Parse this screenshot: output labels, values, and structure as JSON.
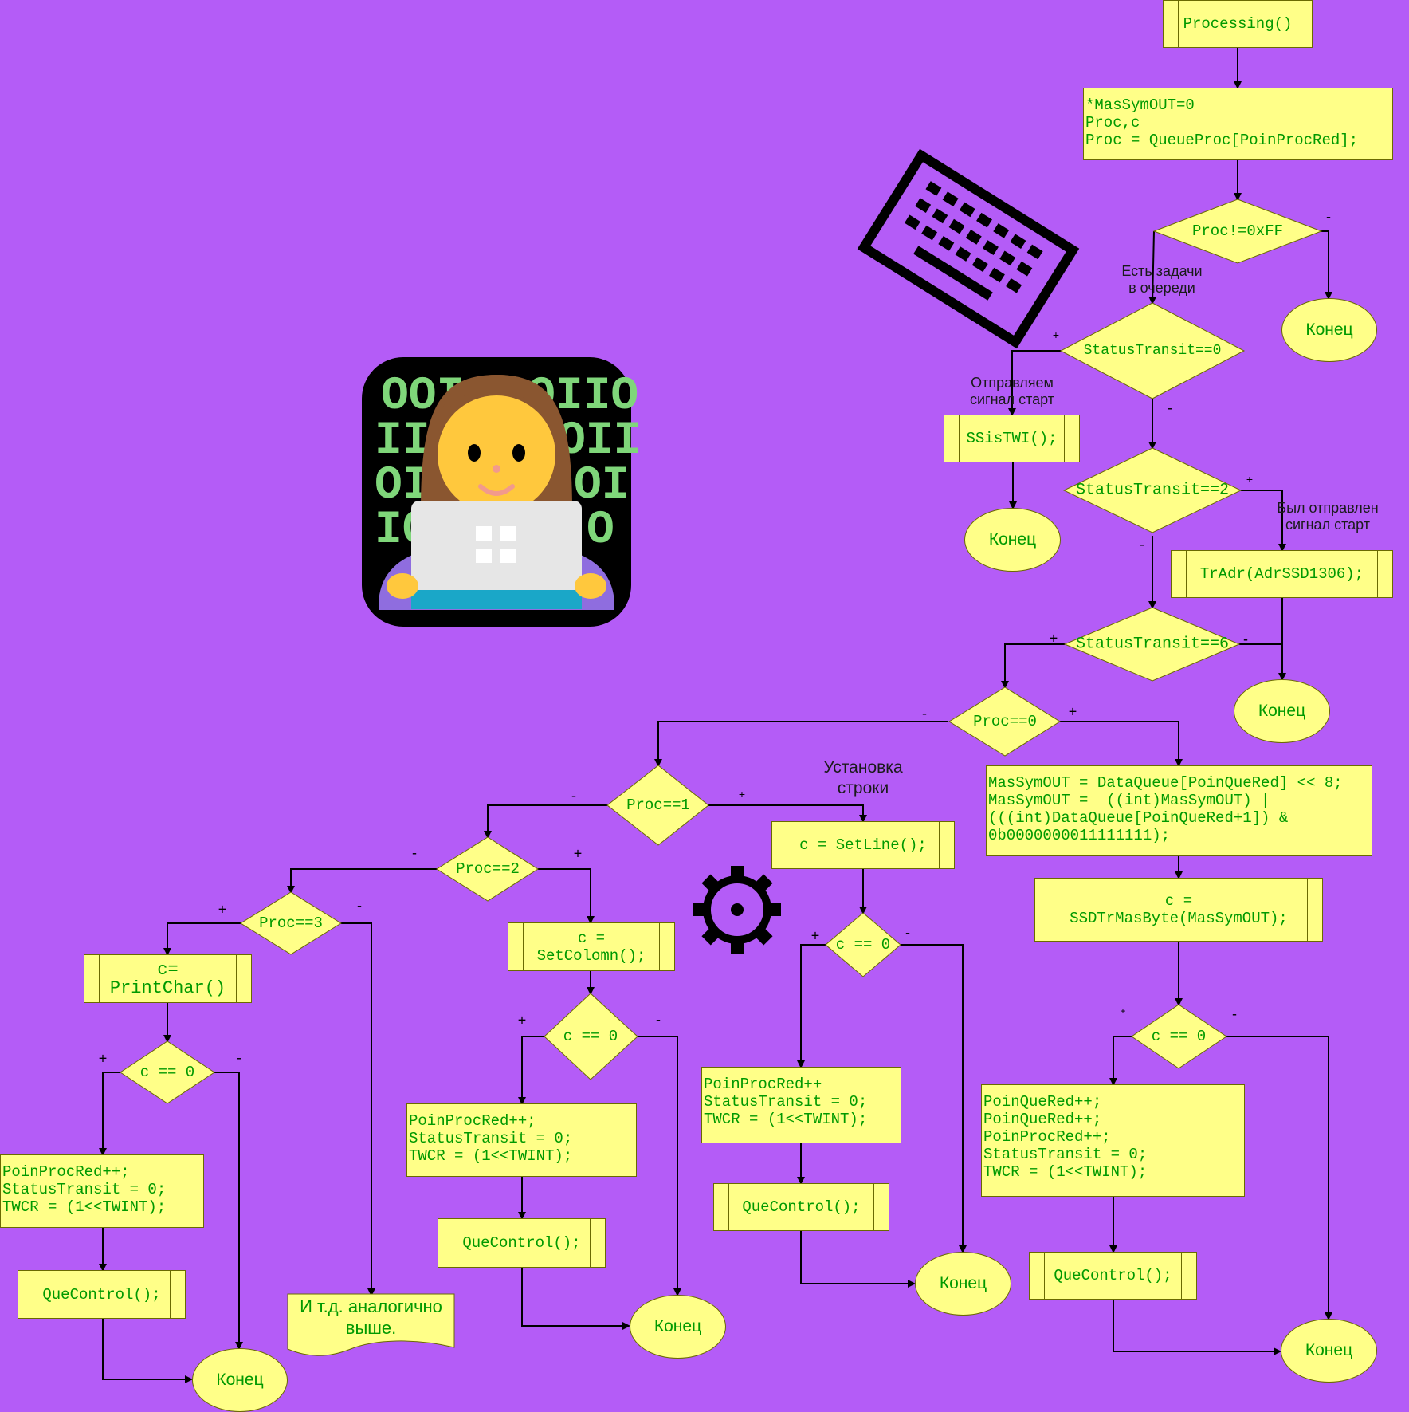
{
  "diagram": {
    "processing": "Processing()",
    "init_block": "*MasSymOUT=0\nProc,c\nProc = QueueProc[PoinProcRed];",
    "dec_proc_ff": "Proc!=0xFF",
    "note_tasks": "Есть задачи\nв очереди",
    "dec_status0": "StatusTransit==0",
    "note_start": "Отправляем\nсигнал старт",
    "sstwi": "SSisTWI();",
    "dec_status2": "StatusTransit==2",
    "note_sent": "Был отправлен\nсигнал старт",
    "tradr": "TrAdr(AdrSSD1306);",
    "dec_status6": "StatusTransit==6",
    "dec_proc0": "Proc==0",
    "mas_block": "MasSymOUT = DataQueue[PoinQueRed] << 8;\nMasSymOUT =  ((int)MasSymOUT) |\n(((int)DataQueue[PoinQueRed+1]) &\n0b0000000011111111);",
    "ssd_block": "c =\nSSDTrMasByte(MasSymOUT);",
    "dec_c0_a": "c == 0",
    "inc_block_a": "PoinQueRed++;\nPoinQueRed++;\nPoinProcRed++;\nStatusTransit = 0;\nTWCR = (1<<TWINT);",
    "quecontrol_a": "QueControl();",
    "dec_proc1": "Proc==1",
    "note_line": "Установка\nстроки",
    "setline": "c = SetLine();",
    "dec_c0_b": "c == 0",
    "inc_block_b": "PoinProcRed++\nStatusTransit = 0;\nTWCR = (1<<TWINT);",
    "quecontrol_b": "QueControl();",
    "dec_proc2": "Proc==2",
    "setcolomn": "c =\nSetColomn();",
    "dec_c0_c": "c == 0",
    "inc_block_c": "PoinProcRed++;\nStatusTransit = 0;\nTWCR = (1<<TWINT);",
    "quecontrol_c": "QueControl();",
    "dec_proc3": "Proc==3",
    "printchar": "c=\nPrintChar()",
    "dec_c0_d": "c == 0",
    "inc_block_d": "PoinProcRed++;\nStatusTransit = 0;\nTWCR = (1<<TWINT);",
    "quecontrol_d": "QueControl();",
    "etc_note": "И т.д. аналогично\nвыше.",
    "end_label": "Конец",
    "plus": "+",
    "minus": "-"
  },
  "colors": {
    "background": "#b45cf7",
    "shape_fill": "#ffff88",
    "shape_text": "#009900",
    "connector": "#000000"
  },
  "icons": [
    "keyboard-icon",
    "woman-technologist-icon",
    "gear-icon"
  ]
}
